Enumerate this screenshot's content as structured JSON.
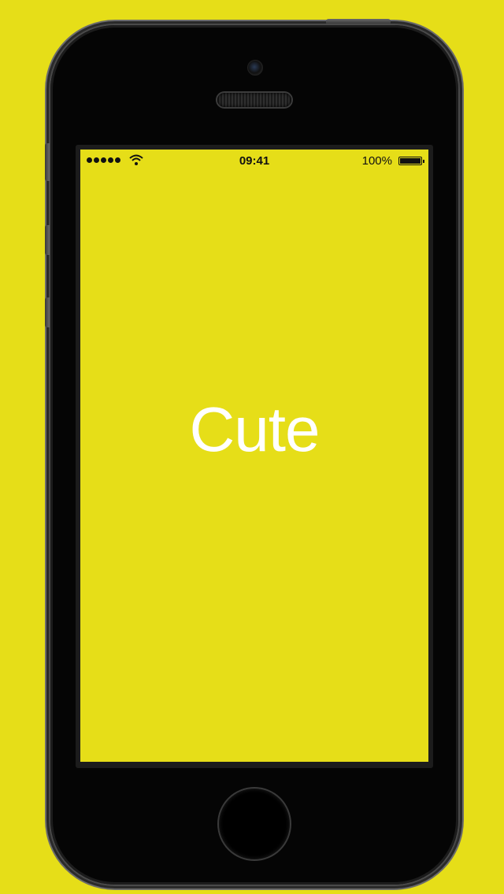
{
  "status_bar": {
    "time": "09:41",
    "battery_percent": "100%",
    "signal_bars": 5
  },
  "screen": {
    "label": "Cute",
    "background_color": "#e6de18",
    "text_color": "#ffffff"
  },
  "icons": {
    "signal": "signal-dots-icon",
    "wifi": "wifi-icon",
    "battery": "battery-icon"
  }
}
